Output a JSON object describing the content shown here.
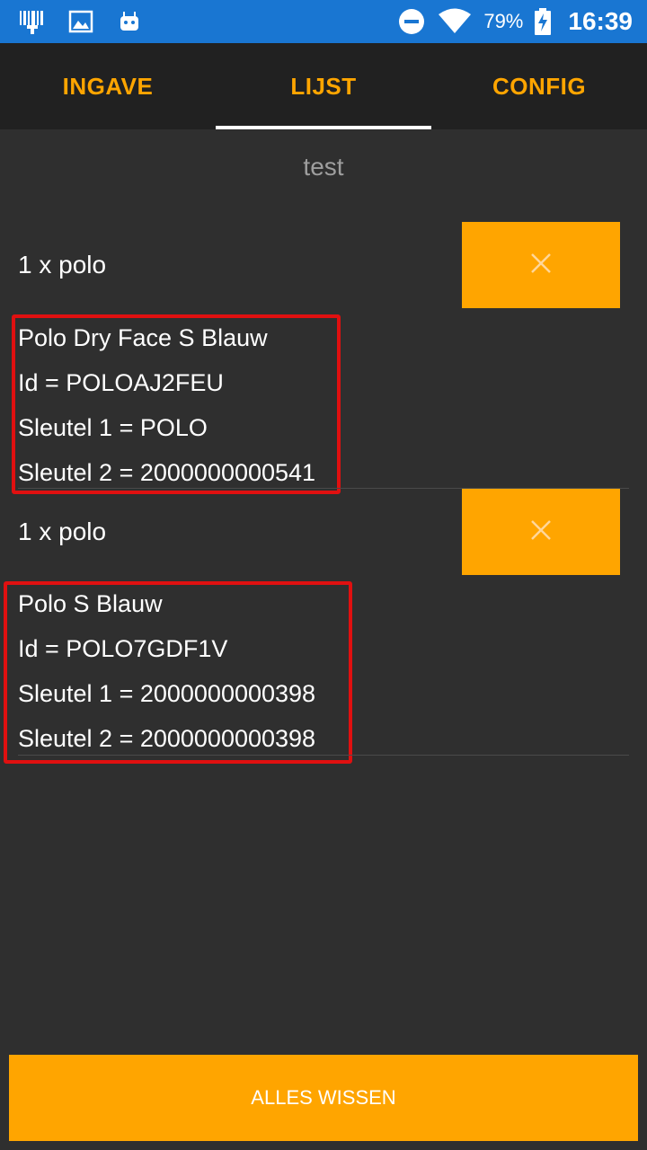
{
  "status_bar": {
    "icons": [
      "barcode-scanner-icon",
      "image-icon",
      "android-icon"
    ],
    "dnd_icon": "do-not-disturb-icon",
    "wifi_icon": "wifi-icon",
    "battery_percent": "79%",
    "battery_icon": "battery-charging-icon",
    "time": "16:39",
    "color": "#1976d2"
  },
  "tabs": [
    {
      "label": "INGAVE",
      "active": false
    },
    {
      "label": "LIJST",
      "active": true
    },
    {
      "label": "CONFIG",
      "active": false
    }
  ],
  "list": {
    "title": "test",
    "items": [
      {
        "qty_label": "1 x polo",
        "remove_icon": "close-icon",
        "lines": [
          "Polo Dry Face S Blauw",
          "Id = POLOAJ2FEU",
          "Sleutel 1 = POLO",
          "Sleutel 2 = 2000000000541"
        ]
      },
      {
        "qty_label": "1 x polo",
        "remove_icon": "close-icon",
        "lines": [
          "Polo S Blauw",
          "Id = POLO7GDF1V",
          "Sleutel 1 = 2000000000398",
          "Sleutel 2 = 2000000000398"
        ]
      }
    ]
  },
  "footer": {
    "clear_all_label": "ALLES WISSEN"
  },
  "colors": {
    "accent": "#ffa500",
    "background": "#2f2f2f",
    "tabbar": "#212121",
    "highlight_border": "#e01010"
  }
}
